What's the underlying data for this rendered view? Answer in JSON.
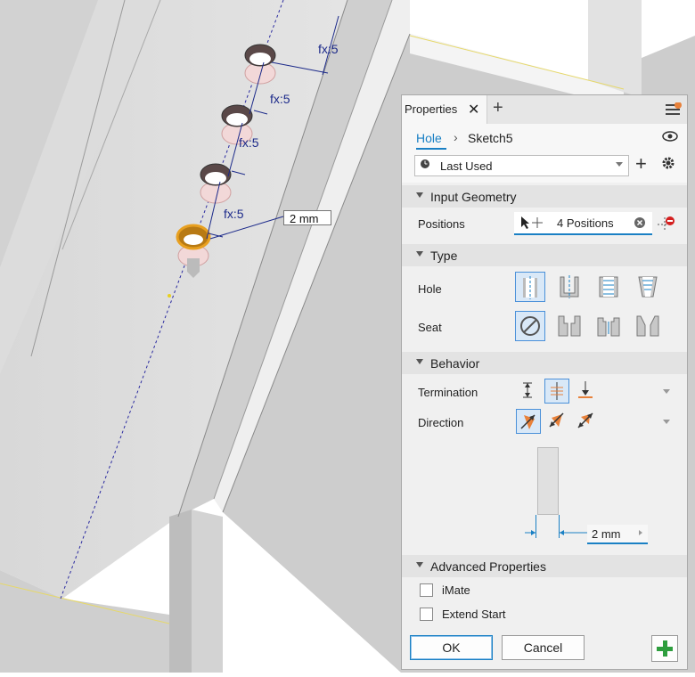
{
  "viewport": {
    "dimension_labels": [
      "fx:5",
      "fx:5",
      "fx:5",
      "fx:5"
    ],
    "dimension_input_value": "2 mm"
  },
  "panel": {
    "tab_label": "Properties",
    "breadcrumb": {
      "root": "Hole",
      "current": "Sketch5"
    },
    "preset": {
      "value": "Last Used"
    },
    "sections": {
      "input_geometry": "Input Geometry",
      "type": "Type",
      "behavior": "Behavior",
      "advanced": "Advanced Properties"
    },
    "input_geometry": {
      "positions_label": "Positions",
      "positions_value": "4 Positions"
    },
    "type": {
      "hole_label": "Hole",
      "seat_label": "Seat"
    },
    "behavior": {
      "termination_label": "Termination",
      "direction_label": "Direction",
      "diameter_value": "2 mm"
    },
    "advanced": {
      "imate_label": "iMate",
      "extend_start_label": "Extend Start"
    },
    "footer": {
      "ok_label": "OK",
      "cancel_label": "Cancel"
    },
    "colors": {
      "accent": "#1a80c4",
      "selected_bg": "#d9e8f7",
      "orange": "#e8813a",
      "add_green": "#2e9e3e"
    }
  }
}
